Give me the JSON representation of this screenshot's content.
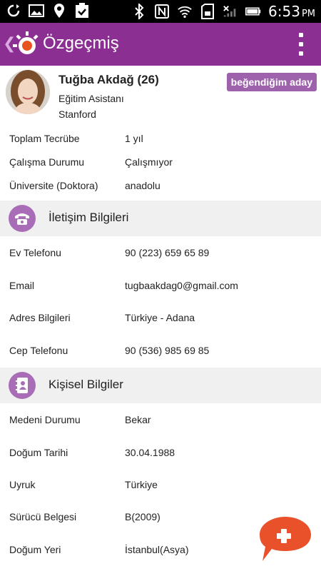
{
  "status": {
    "time": "6:53",
    "ampm": "PM"
  },
  "header": {
    "title": "Özgeçmiş"
  },
  "profile": {
    "name": "Tuğba Akdağ (26)",
    "job": "Eğitim Asistanı",
    "school": "Stanford",
    "badge": "beğendiğim aday"
  },
  "summary": [
    {
      "label": "Toplam Tecrübe",
      "value": "1 yıl"
    },
    {
      "label": "Çalışma Durumu",
      "value": "Çalışmıyor"
    },
    {
      "label": "Üniversite (Doktora)",
      "value": "anadolu"
    }
  ],
  "contact": {
    "title": "İletişim Bilgileri",
    "items": [
      {
        "label": "Ev Telefonu",
        "value": "90 (223) 659 65 89"
      },
      {
        "label": "Email",
        "value": "tugbaakdag0@gmail.com"
      },
      {
        "label": "Adres Bilgileri",
        "value": "Türkiye - Adana"
      },
      {
        "label": "Cep Telefonu",
        "value": "90 (536) 985 69 85"
      }
    ]
  },
  "personal": {
    "title": "Kişisel Bilgiler",
    "items": [
      {
        "label": "Medeni Durumu",
        "value": "Bekar"
      },
      {
        "label": "Doğum Tarihi",
        "value": "30.04.1988"
      },
      {
        "label": "Uyruk",
        "value": "Türkiye"
      },
      {
        "label": "Sürücü Belgesi",
        "value": "B(2009)"
      },
      {
        "label": "Doğum Yeri",
        "value": "İstanbul(Asya)"
      }
    ]
  }
}
